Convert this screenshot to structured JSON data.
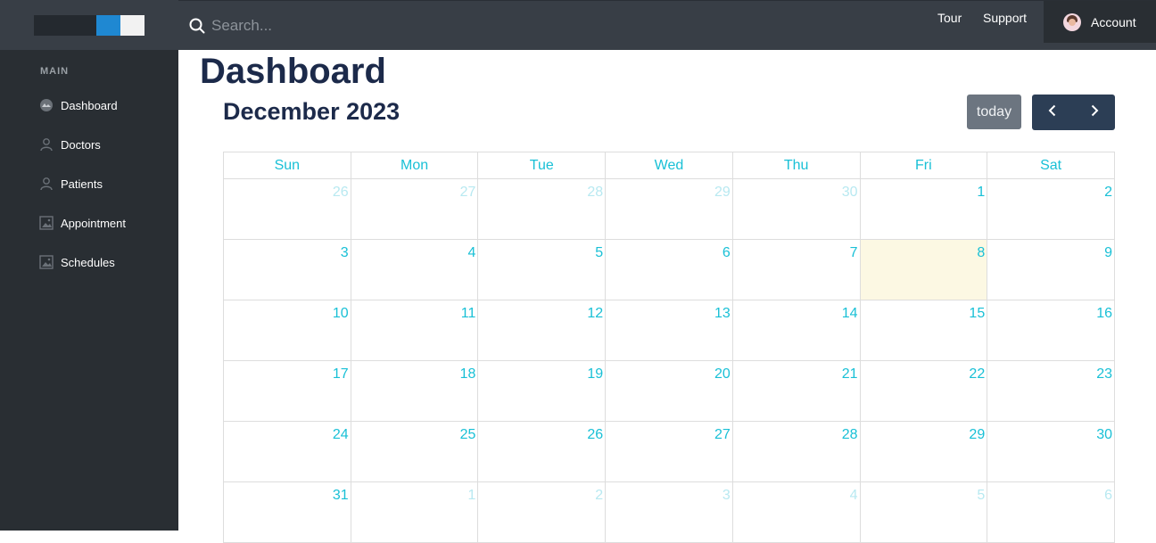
{
  "sidebar": {
    "section_title": "MAIN",
    "items": [
      {
        "label": "Dashboard",
        "icon": "dashboard-icon"
      },
      {
        "label": "Doctors",
        "icon": "user-icon"
      },
      {
        "label": "Patients",
        "icon": "user-icon"
      },
      {
        "label": "Appointment",
        "icon": "image-icon"
      },
      {
        "label": "Schedules",
        "icon": "image-icon"
      }
    ]
  },
  "topbar": {
    "search_placeholder": "Search...",
    "tour_label": "Tour",
    "support_label": "Support",
    "account_label": "Account"
  },
  "main": {
    "page_title": "Dashboard",
    "calendar": {
      "title": "December 2023",
      "today_label": "today",
      "weekdays": [
        "Sun",
        "Mon",
        "Tue",
        "Wed",
        "Thu",
        "Fri",
        "Sat"
      ],
      "weeks": [
        [
          {
            "d": "26",
            "o": true
          },
          {
            "d": "27",
            "o": true
          },
          {
            "d": "28",
            "o": true
          },
          {
            "d": "29",
            "o": true
          },
          {
            "d": "30",
            "o": true
          },
          {
            "d": "1"
          },
          {
            "d": "2"
          }
        ],
        [
          {
            "d": "3"
          },
          {
            "d": "4"
          },
          {
            "d": "5"
          },
          {
            "d": "6"
          },
          {
            "d": "7"
          },
          {
            "d": "8",
            "today": true
          },
          {
            "d": "9"
          }
        ],
        [
          {
            "d": "10"
          },
          {
            "d": "11"
          },
          {
            "d": "12"
          },
          {
            "d": "13"
          },
          {
            "d": "14"
          },
          {
            "d": "15"
          },
          {
            "d": "16"
          }
        ],
        [
          {
            "d": "17"
          },
          {
            "d": "18"
          },
          {
            "d": "19"
          },
          {
            "d": "20"
          },
          {
            "d": "21"
          },
          {
            "d": "22"
          },
          {
            "d": "23"
          }
        ],
        [
          {
            "d": "24"
          },
          {
            "d": "25"
          },
          {
            "d": "26"
          },
          {
            "d": "27"
          },
          {
            "d": "28"
          },
          {
            "d": "29"
          },
          {
            "d": "30"
          }
        ],
        [
          {
            "d": "31"
          },
          {
            "d": "1",
            "o": true
          },
          {
            "d": "2",
            "o": true
          },
          {
            "d": "3",
            "o": true
          },
          {
            "d": "4",
            "o": true
          },
          {
            "d": "5",
            "o": true
          },
          {
            "d": "6",
            "o": true
          }
        ]
      ]
    }
  },
  "colors": {
    "accent": "#19c0d6",
    "title": "#1c2a4a",
    "sidebar_bg": "#292e33",
    "topbar_bg": "#383e46",
    "today_bg": "#fcf8e3"
  }
}
